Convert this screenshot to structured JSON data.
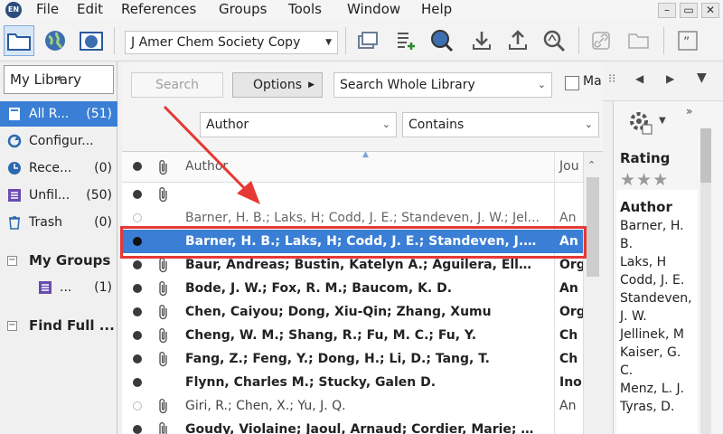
{
  "menu": {
    "items": [
      "File",
      "Edit",
      "References",
      "Groups",
      "Tools",
      "Window",
      "Help"
    ],
    "window_buttons": [
      "–",
      "▭",
      "✕"
    ]
  },
  "toolbar": {
    "style_value": "J Amer Chem Society Copy"
  },
  "sidebar": {
    "library_title": "My Library",
    "groups": [
      {
        "label": "All R...",
        "count": "(51)",
        "icon": "library-icon",
        "selected": true
      },
      {
        "label": "Configur...",
        "count": "",
        "icon": "sync-icon"
      },
      {
        "label": "Rece...",
        "count": "(0)",
        "icon": "clock-icon"
      },
      {
        "label": "Unfil...",
        "count": "(50)",
        "icon": "unfiled-icon"
      },
      {
        "label": "Trash",
        "count": "(0)",
        "icon": "trash-icon"
      }
    ],
    "my_groups_label": "My Groups",
    "my_groups_item": {
      "label": "...",
      "count": "(1)"
    },
    "find_full_label": "Find Full ..."
  },
  "search": {
    "search_label": "Search",
    "options_label": "Options",
    "scope_value": "Search Whole Library",
    "match_label": "Ma",
    "field_value": "Author",
    "operator_value": "Contains"
  },
  "list": {
    "header_author": "Author",
    "header_journal": "Jou",
    "rows": [
      {
        "author": "",
        "journal": "",
        "read": false,
        "attachment": true,
        "weight": "bold"
      },
      {
        "author": "Barner, H. B.; Laks, H; Codd, J. E.; Standeven, J. W.; Jel...",
        "journal": "An",
        "read": true,
        "attachment": false,
        "weight": "faded"
      },
      {
        "author": "Barner, H. B.; Laks, H; Codd, J. E.; Standeven, J. W.; ...",
        "journal": "An",
        "read": false,
        "attachment": false,
        "weight": "selected"
      },
      {
        "author": "Baur, Andreas; Bustin, Katelyn A.; Aguilera, Ellen; P...",
        "journal": "Org",
        "read": false,
        "attachment": true,
        "weight": "bold"
      },
      {
        "author": "Bode, J. W.; Fox, R. M.; Baucom, K. D.",
        "journal": "An",
        "read": false,
        "attachment": true,
        "weight": "bold"
      },
      {
        "author": "Chen, Caiyou; Dong, Xiu-Qin; Zhang, Xumu",
        "journal": "Org",
        "read": false,
        "attachment": true,
        "weight": "bold"
      },
      {
        "author": "Cheng, W. M.; Shang, R.; Fu, M. C.; Fu, Y.",
        "journal": "Ch",
        "read": false,
        "attachment": true,
        "weight": "bold"
      },
      {
        "author": "Fang, Z.; Feng, Y.; Dong, H.; Li, D.; Tang, T.",
        "journal": "Ch",
        "read": false,
        "attachment": true,
        "weight": "bold"
      },
      {
        "author": "Flynn, Charles M.; Stucky, Galen D.",
        "journal": "Ino",
        "read": false,
        "attachment": false,
        "weight": "bold"
      },
      {
        "author": "Giri, R.; Chen, X.; Yu, J. Q.",
        "journal": "An",
        "read": true,
        "attachment": true,
        "weight": "plain"
      },
      {
        "author": "Goudy, Violaine; Jaoul, Arnaud; Cordier, Marie; Clav...",
        "journal": "",
        "read": false,
        "attachment": true,
        "weight": "bold"
      }
    ]
  },
  "right_panel": {
    "rating_label": "Rating",
    "stars": "★★★",
    "author_heading": "Author",
    "author_lines": [
      "Barner, H.",
      "B.",
      "Laks, H",
      "Codd, J. E.",
      "Standeven,",
      "J. W.",
      "Jellinek, M",
      "Kaiser, G.",
      "C.",
      "Menz, L. J.",
      "Tyras, D."
    ]
  },
  "colors": {
    "selection": "#3a7fd5",
    "annotation": "#e53935"
  }
}
